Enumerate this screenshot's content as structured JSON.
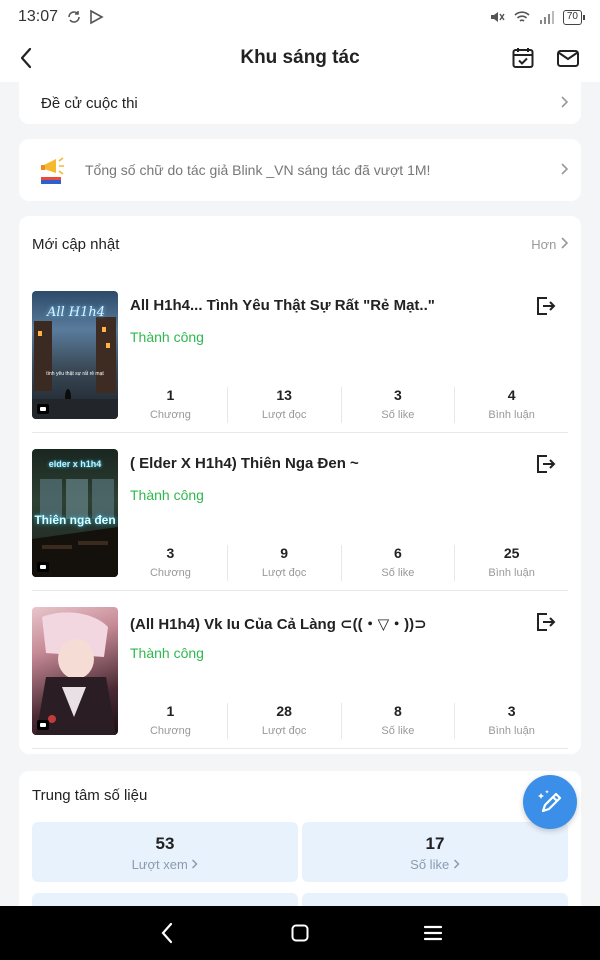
{
  "status_bar": {
    "time": "13:07",
    "battery": "70"
  },
  "header": {
    "title": "Khu sáng tác"
  },
  "contest": {
    "label": "Đề cử cuộc thi"
  },
  "announcement": {
    "text": "Tổng số chữ do tác giả Blink _VN sáng tác đã vượt 1M!"
  },
  "updates": {
    "title": "Mới cập nhật",
    "more": "Hơn",
    "stories": [
      {
        "title": "All H1h4... Tình Yêu Thật Sự Rất \"Rẻ Mạt..\"",
        "status": "Thành công",
        "cover_text": "All H1h4",
        "cover_sub": "tình yêu thật sự rất rẻ mạt",
        "stats": [
          {
            "value": "1",
            "label": "Chương"
          },
          {
            "value": "13",
            "label": "Lượt đọc"
          },
          {
            "value": "3",
            "label": "Số like"
          },
          {
            "value": "4",
            "label": "Bình luận"
          }
        ]
      },
      {
        "title": "( Elder X H1h4) Thiên Nga Đen ~",
        "status": "Thành công",
        "cover_text": "elder x h1h4",
        "cover_sub": "Thiên nga đen",
        "stats": [
          {
            "value": "3",
            "label": "Chương"
          },
          {
            "value": "9",
            "label": "Lượt đọc"
          },
          {
            "value": "6",
            "label": "Số like"
          },
          {
            "value": "25",
            "label": "Bình luận"
          }
        ]
      },
      {
        "title": "(All H1h4) Vk Iu Của Cả Làng ⊂((・▽・))⊃",
        "status": "Thành công",
        "cover_text": "",
        "cover_sub": "",
        "stats": [
          {
            "value": "1",
            "label": "Chương"
          },
          {
            "value": "28",
            "label": "Lượt đọc"
          },
          {
            "value": "8",
            "label": "Số like"
          },
          {
            "value": "3",
            "label": "Bình luận"
          }
        ]
      }
    ]
  },
  "data_center": {
    "title": "Trung tâm số liệu",
    "views": {
      "value": "53",
      "label": "Lượt xem"
    },
    "likes": {
      "value": "17",
      "label": "Số like"
    }
  },
  "icons": {
    "back": "chevron-left-icon",
    "calendar": "calendar-check-icon",
    "mail": "mail-icon",
    "megaphone": "megaphone-icon",
    "export": "export-icon",
    "edit": "magic-pen-icon"
  },
  "colors": {
    "accent": "#3b8fe8",
    "success": "#2fb84f",
    "stat_box": "#e8f2fd"
  }
}
